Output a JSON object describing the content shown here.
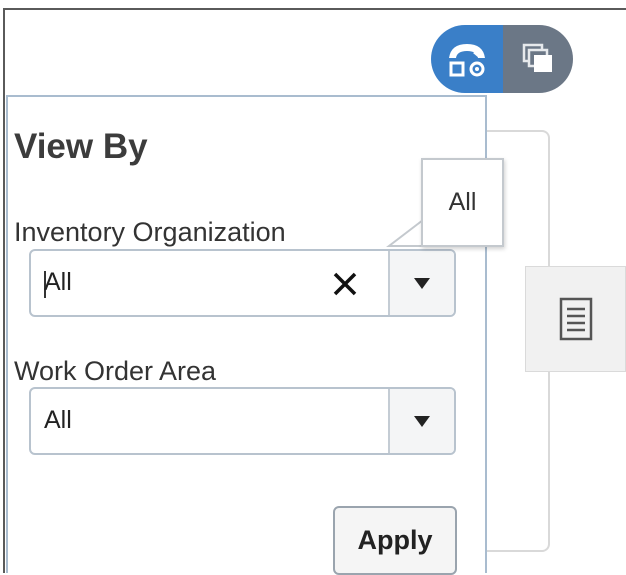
{
  "popup": {
    "title": "View By",
    "inventory_org": {
      "label": "Inventory Organization",
      "value": "All"
    },
    "work_order_area": {
      "label": "Work Order Area",
      "value": "All"
    },
    "apply_label": "Apply"
  },
  "tooltip": {
    "text": "All"
  },
  "toolbar": {
    "graph_view_icon": "graph-view-icon",
    "table_view_icon": "table-view-icon",
    "active_color": "#3a7fc8",
    "inactive_color": "#6b7786"
  },
  "report_icon": "report-document-icon"
}
